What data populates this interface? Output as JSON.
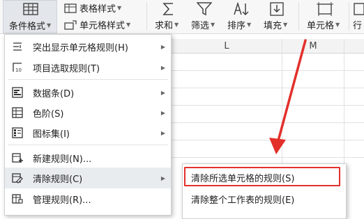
{
  "ribbon": {
    "conditional_format": "条件格式",
    "table_style": "表格样式",
    "cell_style": "单元格样式",
    "sum": "求和",
    "filter": "筛选",
    "sort": "排序",
    "fill": "填充",
    "cell": "单元格",
    "row_col": "行"
  },
  "sheet": {
    "columns": [
      "L",
      "M"
    ]
  },
  "menu": {
    "items": [
      {
        "label": "突出显示单元格规则(H)",
        "icon": "highlight-rules-icon",
        "submenu": true
      },
      {
        "label": "项目选取规则(T)",
        "icon": "top-bottom-rules-icon",
        "submenu": true
      },
      {
        "label": "数据条(D)",
        "icon": "data-bars-icon",
        "submenu": true
      },
      {
        "label": "色阶(S)",
        "icon": "color-scales-icon",
        "submenu": true
      },
      {
        "label": "图标集(I)",
        "icon": "icon-sets-icon",
        "submenu": true
      },
      {
        "label": "新建规则(N)...",
        "icon": "new-rule-icon",
        "submenu": false
      },
      {
        "label": "清除规则(C)",
        "icon": "clear-rules-icon",
        "submenu": true
      },
      {
        "label": "管理规则(R)...",
        "icon": "manage-rules-icon",
        "submenu": false
      }
    ]
  },
  "submenu": {
    "items": [
      "清除所选单元格的规则(S)",
      "清除整个工作表的规则(E)"
    ],
    "highlighted_index": 0
  },
  "colors": {
    "highlight_border": "#e3302b",
    "arrow": "#e3302b",
    "hover_bg": "#e9ecef"
  }
}
